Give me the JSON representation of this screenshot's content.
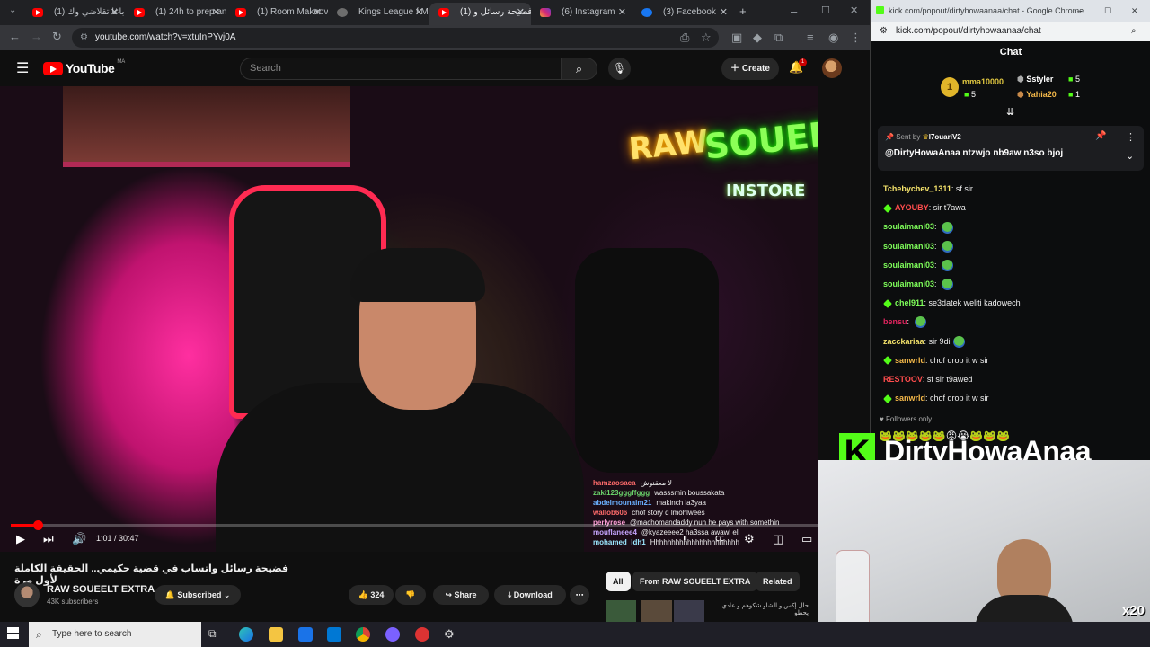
{
  "browser_tabs": [
    {
      "label": "باغا تقلاضي وك (1)",
      "active": false
    },
    {
      "label": "(1) 24h to prep an",
      "active": false
    },
    {
      "label": "(1) Room Makeov",
      "active": false
    },
    {
      "label": "Kings League f Me",
      "active": false
    },
    {
      "label": "فضيحة رسائل و (1)",
      "active": true
    },
    {
      "label": "(6) Instagram",
      "active": false
    },
    {
      "label": "(3) Facebook",
      "active": false
    }
  ],
  "url": "youtube.com/watch?v=xtuInPYvj0A",
  "youtube": {
    "logo": "YouTube",
    "logo_country": "MA",
    "search_placeholder": "Search",
    "create_label": "Create",
    "notif_count": "1"
  },
  "video": {
    "neon_left": "RAW",
    "neon_right": "SOUEELT",
    "neon_sub": "INSTORE",
    "time_current": "1:01",
    "time_total": "30:47",
    "progress_fraction": 0.033,
    "title": "فضيحة رسائل واتساب في قضية حكيمي.. الحقيقة الكاملة لأول مرة",
    "channel": "RAW SOUEELT EXTRA",
    "subscribers": "43K subscribers",
    "subscribed_label": "Subscribed",
    "likes": "324",
    "share_label": "Share",
    "download_label": "Download"
  },
  "overlay_chat": [
    {
      "user": "hamzaosaca",
      "color": "#ff6b6b",
      "text": "لا معقنوش"
    },
    {
      "user": "zaki123gggffggg",
      "color": "#6bd46b",
      "text": "wasssmin boussakata"
    },
    {
      "user": "abdelmounaim21",
      "color": "#6bb0ff",
      "text": "makinch la3yaa"
    },
    {
      "user": "wallob606",
      "color": "#ff6b6b",
      "text": "chof story d lmohlwees"
    },
    {
      "user": "perlyrose",
      "color": "#ff9fd6",
      "text": "@machomandaddy nuh he pays with somethin"
    },
    {
      "user": "mouflaneee4",
      "color": "#c7a6ff",
      "text": "@kyazeeee2 ha3ssa awawl eli"
    },
    {
      "user": "mohamed_ldh1",
      "color": "#9be7ff",
      "text": "Hhhhhhhhhhhhhhhhhhhhhh"
    }
  ],
  "chips": [
    "All",
    "From RAW SOUEELT EXTRA",
    "Related"
  ],
  "related_snippet": "حال إكس و الشاو شكوهم و عادي يحطو",
  "chat_popout": {
    "window_url": "kick.com/popout/dirtyhowaanaa/chat - Google Chrome",
    "addr": "kick.com/popout/dirtyhowaanaa/chat",
    "title": "Chat",
    "leaderboard": [
      {
        "rank": "1",
        "user": "mma10000",
        "count": "5"
      },
      {
        "rank": "",
        "user": "Sstyler",
        "count": "5"
      },
      {
        "rank": "",
        "user": "Yahia20",
        "count": "1"
      }
    ],
    "pinned_sent_by_label": "Sent by",
    "pinned_sender": "l7ouariV2",
    "pinned_message": "@DirtyHowaAnaa ntzwjo nb9aw n3so bjoj",
    "messages": [
      {
        "user": "Tchebychev_1311",
        "color": "#f5e36b",
        "text": "sf sir",
        "emote": false
      },
      {
        "user": "AYOUBY",
        "color": "#ff4d4d",
        "text": "sir t7awa",
        "emote": false
      },
      {
        "user": "soulaimani03",
        "color": "#7fff5a",
        "text": "",
        "emote": true
      },
      {
        "user": "soulaimani03",
        "color": "#7fff5a",
        "text": "",
        "emote": true
      },
      {
        "user": "soulaimani03",
        "color": "#7fff5a",
        "text": "",
        "emote": true
      },
      {
        "user": "soulaimani03",
        "color": "#7fff5a",
        "text": "",
        "emote": true
      },
      {
        "user": "chel911",
        "color": "#7fff5a",
        "text": "se3datek weliti kadowech",
        "emote": false
      },
      {
        "user": "bensu",
        "color": "#e0245e",
        "text": "",
        "emote": true
      },
      {
        "user": "zacckariaa",
        "color": "#f5e36b",
        "text": "sir 9di",
        "emote": true
      },
      {
        "user": "sanwrld",
        "color": "#f5b94a",
        "text": "chof drop it w sir",
        "emote": false
      },
      {
        "user": "RESTOOV",
        "color": "#ff4d4d",
        "text": "sf sir t9awed",
        "emote": false
      },
      {
        "user": "sanwrld",
        "color": "#f5b94a",
        "text": "chof drop it w sir",
        "emote": false
      }
    ],
    "followers_only": "Followers only"
  },
  "stream_overlay": {
    "streamer": "DirtyHowaAnaa",
    "multiplier": "x20"
  },
  "taskbar": {
    "search_placeholder": "Type here to search"
  }
}
